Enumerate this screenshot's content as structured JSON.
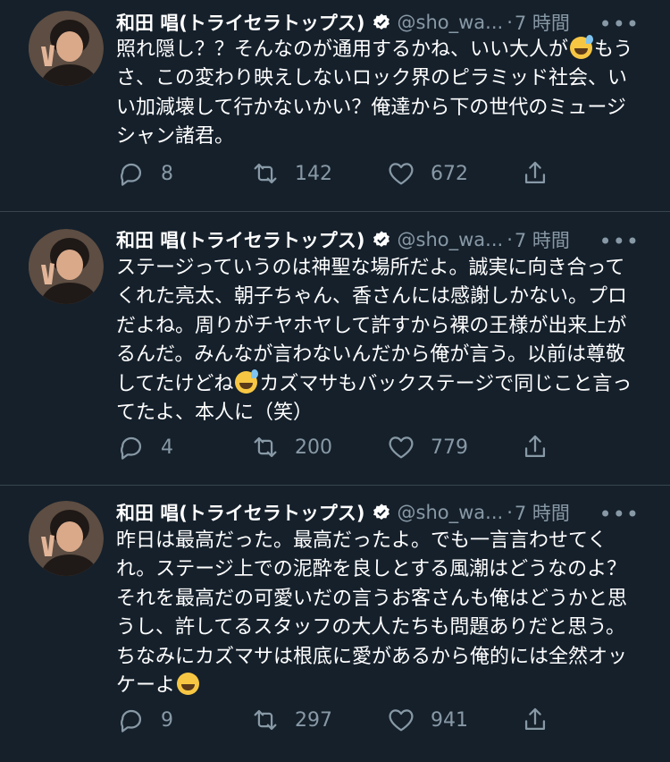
{
  "colors": {
    "background": "#15202b",
    "divider": "#38444d",
    "secondary": "#8899a6",
    "verified": "#ffffff"
  },
  "tweets": [
    {
      "name": "和田 唱(トライセラトップス)",
      "handle": "@sho_wa...",
      "dot": "·",
      "time": "7 時間",
      "more": "•••",
      "text_a": "照れ隠し？？そんなのが通用するかね、いい大人が",
      "text_b": "もうさ、この変わり映えしないロック界のピラミッド社会、いい加減壊して行かないかい？俺達から下の世代のミュージシャン諸君。",
      "reply": "8",
      "retweet": "142",
      "like": "672"
    },
    {
      "name": "和田 唱(トライセラトップス)",
      "handle": "@sho_wa...",
      "dot": "·",
      "time": "7 時間",
      "more": "•••",
      "text_a": "ステージっていうのは神聖な場所だよ。誠実に向き合ってくれた亮太、朝子ちゃん、香さんには感謝しかない。プロだよね。周りがチヤホヤして許すから裸の王様が出来上がるんだ。みんなが言わないんだから俺が言う。以前は尊敬してたけどね",
      "text_b": "カズマサもバックステージで同じこと言ってたよ、本人に（笑）",
      "reply": "4",
      "retweet": "200",
      "like": "779"
    },
    {
      "name": "和田 唱(トライセラトップス)",
      "handle": "@sho_wa...",
      "dot": "·",
      "time": "7 時間",
      "more": "•••",
      "text_a": "昨日は最高だった。最高だったよ。でも一言言わせてくれ。ステージ上での泥酔を良しとする風潮はどうなのよ？それを最高だの可愛いだの言うお客さんも俺はどうかと思うし、許してるスタッフの大人たちも問題ありだと思う。ちなみにカズマサは根底に愛があるから俺的には全然オッケーよ",
      "text_b": "",
      "reply": "9",
      "retweet": "297",
      "like": "941"
    }
  ]
}
